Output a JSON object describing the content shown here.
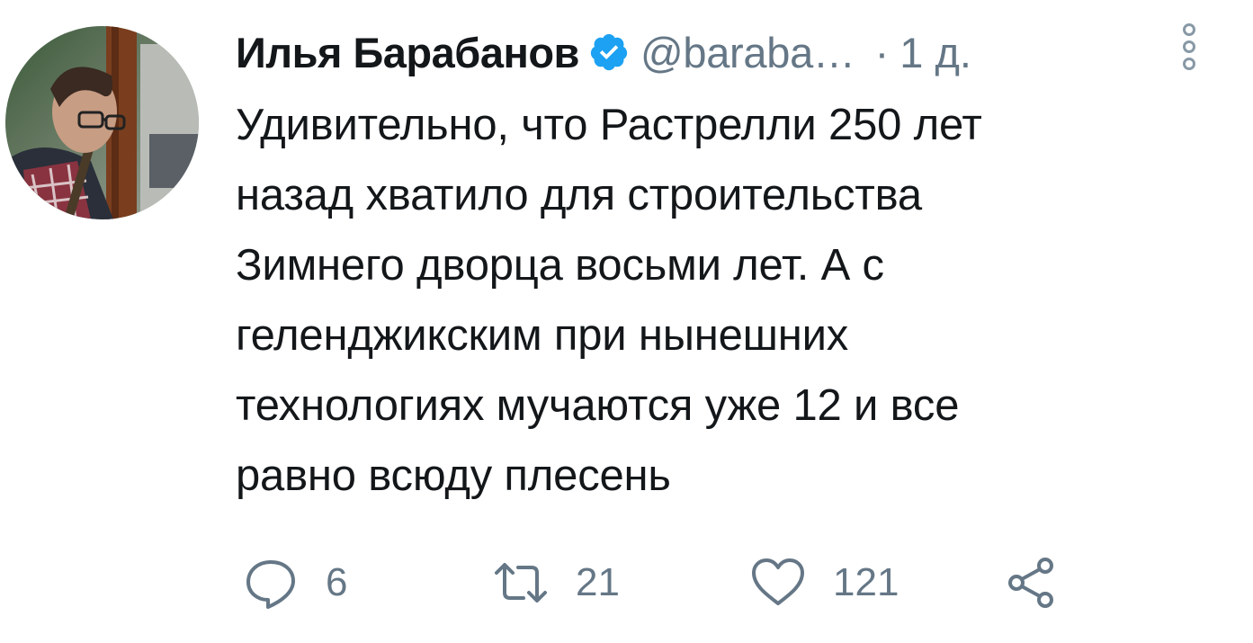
{
  "tweet": {
    "author_name": "Илья Барабанов",
    "author_handle": "@baraba…",
    "separator": "·",
    "time": "1 д.",
    "text": "Удивительно, что Растрелли 250 лет\nназад хватило для строительства\nЗимнего дворца восьми лет. А с\nгеленджикским при нынешних\nтехнологиях мучаются уже 12 и все\nравно всюду плесень"
  },
  "actions": {
    "replies": "6",
    "retweets": "21",
    "likes": "121"
  },
  "icons": {
    "avatar": "avatar-photo",
    "verified": "verified-badge-icon",
    "more": "more-vertical-icon",
    "reply": "reply-icon",
    "retweet": "retweet-icon",
    "like": "heart-icon",
    "share": "share-icon"
  },
  "colors": {
    "text": "#14171a",
    "secondary": "#657786",
    "verified": "#1da1f2"
  }
}
